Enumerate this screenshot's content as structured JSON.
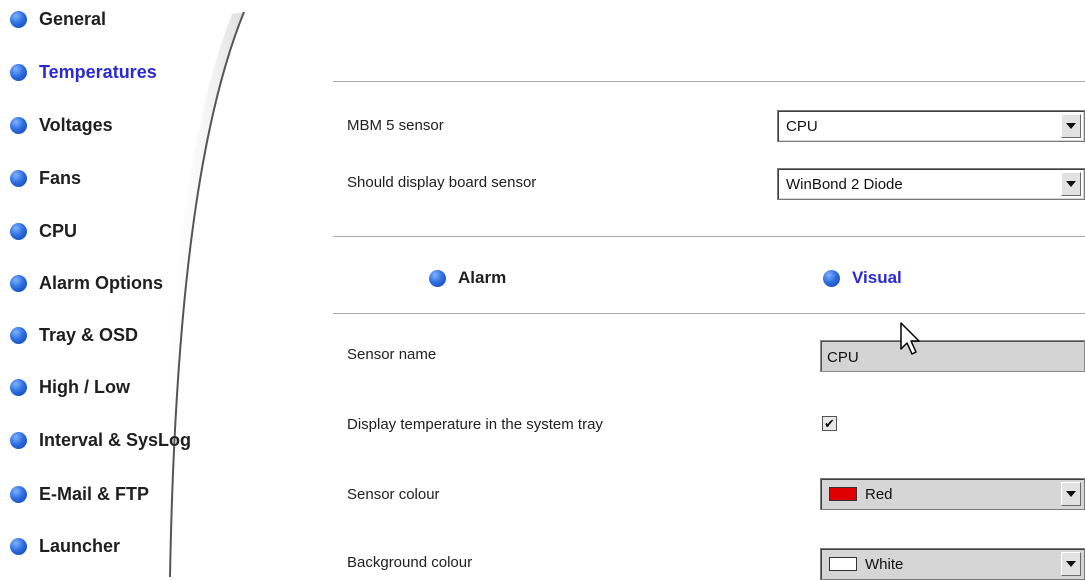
{
  "sidebar": {
    "items": [
      {
        "label": "General",
        "active": false
      },
      {
        "label": "Temperatures",
        "active": true
      },
      {
        "label": "Voltages",
        "active": false
      },
      {
        "label": "Fans",
        "active": false
      },
      {
        "label": "CPU",
        "active": false
      },
      {
        "label": "Alarm Options",
        "active": false
      },
      {
        "label": "Tray & OSD",
        "active": false
      },
      {
        "label": "High / Low",
        "active": false
      },
      {
        "label": "Interval & SysLog",
        "active": false
      },
      {
        "label": "E-Mail & FTP",
        "active": false
      },
      {
        "label": "Launcher",
        "active": false
      }
    ],
    "bullet_icon": "blue-ball-icon"
  },
  "settings": {
    "mbm_sensor": {
      "label": "MBM 5 sensor",
      "value": "CPU"
    },
    "board_sensor": {
      "label": "Should display board sensor",
      "value": "WinBond 2 Diode"
    }
  },
  "tabs": [
    {
      "label": "Alarm",
      "active": false
    },
    {
      "label": "Visual",
      "active": true
    }
  ],
  "visual": {
    "sensor_name": {
      "label": "Sensor name",
      "value": "CPU"
    },
    "display_in_tray": {
      "label": "Display temperature in the system tray",
      "checked": true,
      "check_glyph": "✔"
    },
    "sensor_colour": {
      "label": "Sensor colour",
      "value": "Red",
      "swatch": "#e00000"
    },
    "background_colour": {
      "label": "Background colour",
      "value": "White",
      "swatch": "#ffffff"
    }
  },
  "colors": {
    "active_text": "#2a2ad0",
    "bullet": "#2f6fe0"
  }
}
